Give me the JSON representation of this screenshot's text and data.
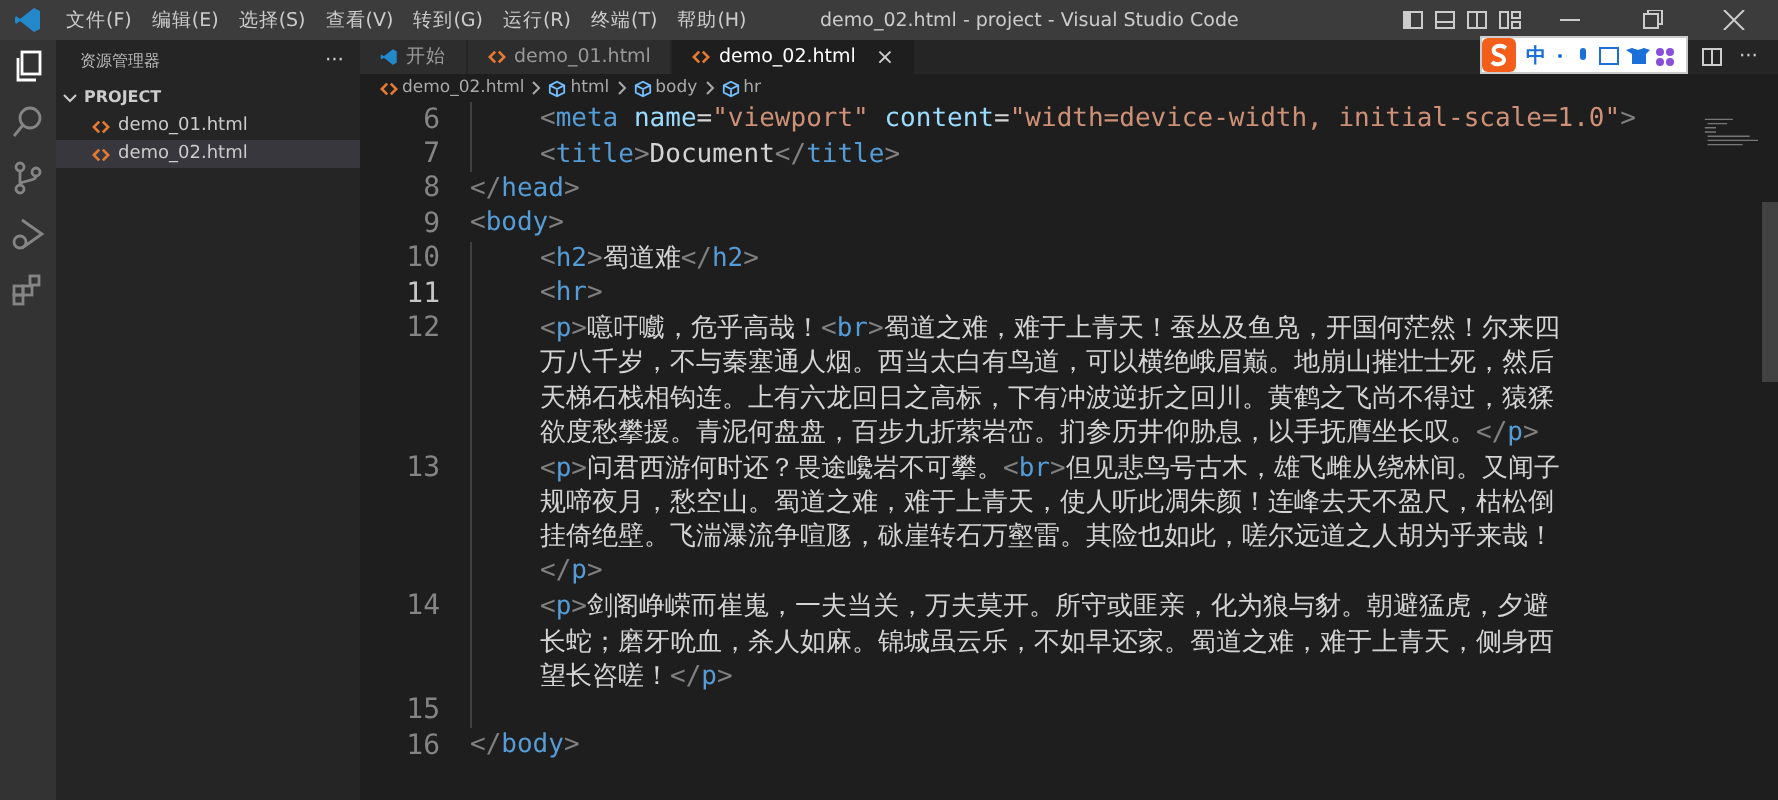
{
  "window": {
    "title": "demo_02.html - project - Visual Studio Code"
  },
  "menu": [
    "文件(F)",
    "编辑(E)",
    "选择(S)",
    "查看(V)",
    "转到(G)",
    "运行(R)",
    "终端(T)",
    "帮助(H)"
  ],
  "activity_bar": [
    {
      "kind": "explorer",
      "selected": true
    },
    {
      "kind": "search",
      "selected": false
    },
    {
      "kind": "source-control",
      "selected": false
    },
    {
      "kind": "run",
      "selected": false
    },
    {
      "kind": "extensions",
      "selected": false
    }
  ],
  "sidebar": {
    "title": "资源管理器",
    "more": "···",
    "section": "PROJECT",
    "expanded": true,
    "files": [
      {
        "name": "demo_01.html",
        "selected": false
      },
      {
        "name": "demo_02.html",
        "selected": true
      }
    ]
  },
  "tabs": [
    {
      "label": "开始",
      "kind": "welcome",
      "selected": false
    },
    {
      "label": "demo_01.html",
      "kind": "html",
      "selected": false
    },
    {
      "label": "demo_02.html",
      "kind": "html",
      "selected": true,
      "close": "×"
    }
  ],
  "editor_actions": {
    "more": "···"
  },
  "breadcrumb": [
    {
      "label": "demo_02.html",
      "kind": "file"
    },
    {
      "label": "html",
      "kind": "element"
    },
    {
      "label": "body",
      "kind": "element"
    },
    {
      "label": "hr",
      "kind": "element"
    }
  ],
  "ime_toolbar": {
    "label": "中"
  },
  "code": [
    {
      "number": "6",
      "current": false,
      "rows": [
        {
          "indented": true,
          "tokens": [
            {
              "kind": "punct",
              "text": "<"
            },
            {
              "kind": "tag",
              "text": "meta"
            },
            {
              "kind": "attr",
              "text": " name"
            },
            {
              "kind": "text",
              "text": "="
            },
            {
              "kind": "string",
              "text": "\"viewport\""
            },
            {
              "kind": "attr",
              "text": " content"
            },
            {
              "kind": "text",
              "text": "="
            },
            {
              "kind": "string",
              "text": "\"width=device-width, initial-scale=1.0\""
            },
            {
              "kind": "punct",
              "text": ">"
            }
          ]
        }
      ]
    },
    {
      "number": "7",
      "current": false,
      "rows": [
        {
          "indented": true,
          "tokens": [
            {
              "kind": "punct",
              "text": "<"
            },
            {
              "kind": "tag",
              "text": "title"
            },
            {
              "kind": "punct",
              "text": ">"
            },
            {
              "kind": "text",
              "text": "Document"
            },
            {
              "kind": "punct",
              "text": "</"
            },
            {
              "kind": "tag",
              "text": "title"
            },
            {
              "kind": "punct",
              "text": ">"
            }
          ]
        }
      ]
    },
    {
      "number": "8",
      "current": false,
      "rows": [
        {
          "indented": false,
          "tokens": [
            {
              "kind": "punct",
              "text": "</"
            },
            {
              "kind": "tag",
              "text": "head"
            },
            {
              "kind": "punct",
              "text": ">"
            }
          ]
        }
      ]
    },
    {
      "number": "9",
      "current": false,
      "rows": [
        {
          "indented": false,
          "tokens": [
            {
              "kind": "punct",
              "text": "<"
            },
            {
              "kind": "tag",
              "text": "body"
            },
            {
              "kind": "punct",
              "text": ">"
            }
          ]
        }
      ]
    },
    {
      "number": "10",
      "current": false,
      "rows": [
        {
          "indented": true,
          "tokens": [
            {
              "kind": "punct",
              "text": "<"
            },
            {
              "kind": "tag",
              "text": "h2"
            },
            {
              "kind": "punct",
              "text": ">"
            },
            {
              "kind": "text",
              "text": "蜀道难"
            },
            {
              "kind": "punct",
              "text": "</"
            },
            {
              "kind": "tag",
              "text": "h2"
            },
            {
              "kind": "punct",
              "text": ">"
            }
          ]
        }
      ]
    },
    {
      "number": "11",
      "current": true,
      "rows": [
        {
          "indented": true,
          "tokens": [
            {
              "kind": "punct",
              "text": "<"
            },
            {
              "kind": "tag",
              "text": "hr"
            },
            {
              "kind": "punct",
              "text": ">"
            }
          ]
        }
      ]
    },
    {
      "number": "12",
      "current": false,
      "rows": [
        {
          "indented": true,
          "tokens": [
            {
              "kind": "punct",
              "text": "<"
            },
            {
              "kind": "tag",
              "text": "p"
            },
            {
              "kind": "punct",
              "text": ">"
            },
            {
              "kind": "text",
              "text": "噫吁嚱，危乎高哉！"
            },
            {
              "kind": "punct",
              "text": "<"
            },
            {
              "kind": "tag",
              "text": "br"
            },
            {
              "kind": "punct",
              "text": ">"
            },
            {
              "kind": "text",
              "text": "蜀道之难，难于上青天！蚕丛及鱼凫，开国何茫然！尔来四"
            }
          ]
        },
        {
          "indented": true,
          "tokens": [
            {
              "kind": "text",
              "text": "万八千岁，不与秦塞通人烟。西当太白有鸟道，可以横绝峨眉巅。地崩山摧壮士死，然后"
            }
          ]
        },
        {
          "indented": true,
          "tokens": [
            {
              "kind": "text",
              "text": "天梯石栈相钩连。上有六龙回日之高标，下有冲波逆折之回川。黄鹤之飞尚不得过，猿猱"
            }
          ]
        },
        {
          "indented": true,
          "tokens": [
            {
              "kind": "text",
              "text": "欲度愁攀援。青泥何盘盘，百步九折萦岩峦。扪参历井仰胁息，以手抚膺坐长叹。"
            },
            {
              "kind": "punct",
              "text": "</"
            },
            {
              "kind": "tag",
              "text": "p"
            },
            {
              "kind": "punct",
              "text": ">"
            }
          ]
        }
      ]
    },
    {
      "number": "13",
      "current": false,
      "rows": [
        {
          "indented": true,
          "tokens": [
            {
              "kind": "punct",
              "text": "<"
            },
            {
              "kind": "tag",
              "text": "p"
            },
            {
              "kind": "punct",
              "text": ">"
            },
            {
              "kind": "text",
              "text": "问君西游何时还？畏途巉岩不可攀。"
            },
            {
              "kind": "punct",
              "text": "<"
            },
            {
              "kind": "tag",
              "text": "br"
            },
            {
              "kind": "punct",
              "text": ">"
            },
            {
              "kind": "text",
              "text": "但见悲鸟号古木，雄飞雌从绕林间。又闻子"
            }
          ]
        },
        {
          "indented": true,
          "tokens": [
            {
              "kind": "text",
              "text": "规啼夜月，愁空山。蜀道之难，难于上青天，使人听此凋朱颜！连峰去天不盈尺，枯松倒"
            }
          ]
        },
        {
          "indented": true,
          "tokens": [
            {
              "kind": "text",
              "text": "挂倚绝壁。飞湍瀑流争喧豗，砯崖转石万壑雷。其险也如此，嗟尔远道之人胡为乎来哉！"
            }
          ]
        },
        {
          "indented": true,
          "tokens": [
            {
              "kind": "punct",
              "text": "</"
            },
            {
              "kind": "tag",
              "text": "p"
            },
            {
              "kind": "punct",
              "text": ">"
            }
          ]
        }
      ]
    },
    {
      "number": "14",
      "current": false,
      "rows": [
        {
          "indented": true,
          "tokens": [
            {
              "kind": "punct",
              "text": "<"
            },
            {
              "kind": "tag",
              "text": "p"
            },
            {
              "kind": "punct",
              "text": ">"
            },
            {
              "kind": "text",
              "text": "剑阁峥嵘而崔嵬，一夫当关，万夫莫开。所守或匪亲，化为狼与豺。朝避猛虎，夕避"
            }
          ]
        },
        {
          "indented": true,
          "tokens": [
            {
              "kind": "text",
              "text": "长蛇；磨牙吮血，杀人如麻。锦城虽云乐，不如早还家。蜀道之难，难于上青天，侧身西"
            }
          ]
        },
        {
          "indented": true,
          "tokens": [
            {
              "kind": "text",
              "text": "望长咨嗟！"
            },
            {
              "kind": "punct",
              "text": "</"
            },
            {
              "kind": "tag",
              "text": "p"
            },
            {
              "kind": "punct",
              "text": ">"
            }
          ]
        }
      ]
    },
    {
      "number": "15",
      "current": false,
      "rows": [
        {
          "indented": true,
          "tokens": []
        }
      ]
    },
    {
      "number": "16",
      "current": false,
      "rows": [
        {
          "indented": false,
          "tokens": [
            {
              "kind": "punct",
              "text": "</"
            },
            {
              "kind": "tag",
              "text": "body"
            },
            {
              "kind": "punct",
              "text": ">"
            }
          ]
        }
      ]
    }
  ]
}
